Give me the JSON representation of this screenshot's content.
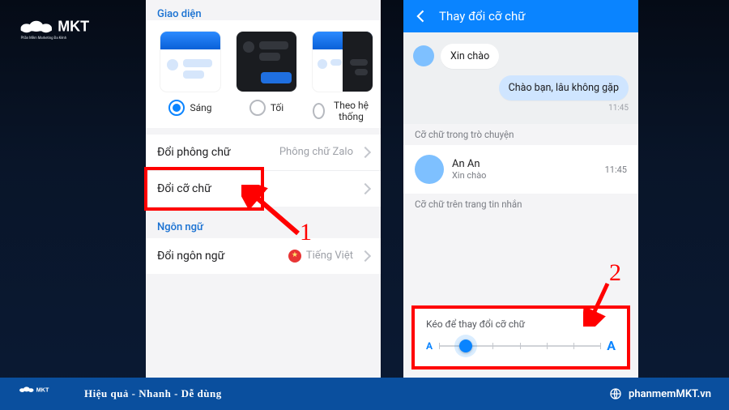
{
  "brand": "MKT",
  "brand_sub": "Phần Mềm Marketing Đa Kênh",
  "footer": {
    "tagline": "Hiệu quả - Nhanh - Dễ dùng",
    "site": "phanmemMKT.vn"
  },
  "annotations": {
    "step1": "1",
    "step2": "2"
  },
  "left": {
    "section_interface": "Giao diện",
    "themes": {
      "light": "Sáng",
      "dark": "Tối",
      "auto": "Theo hệ thống"
    },
    "rows": {
      "font": {
        "label": "Đổi phông chữ",
        "hint": "Phông chữ Zalo"
      },
      "size": {
        "label": "Đổi cỡ chữ"
      }
    },
    "section_lang": "Ngôn ngữ",
    "lang_row": {
      "label": "Đổi ngôn ngữ",
      "value": "Tiếng Việt"
    }
  },
  "right": {
    "title": "Thay đổi cỡ chữ",
    "msg1": "Xin chào",
    "msg2": "Chào bạn, lâu không gặp",
    "msg2_time": "11:45",
    "caption1": "Cỡ chữ trong trò chuyện",
    "contact": {
      "name": "An An",
      "sub": "Xin chào",
      "time": "11:45"
    },
    "caption2": "Cỡ chữ trên trang tin nhắn",
    "slider_label": "Kéo để thay đổi cỡ chữ",
    "slider_a_small": "A",
    "slider_a_big": "A"
  }
}
